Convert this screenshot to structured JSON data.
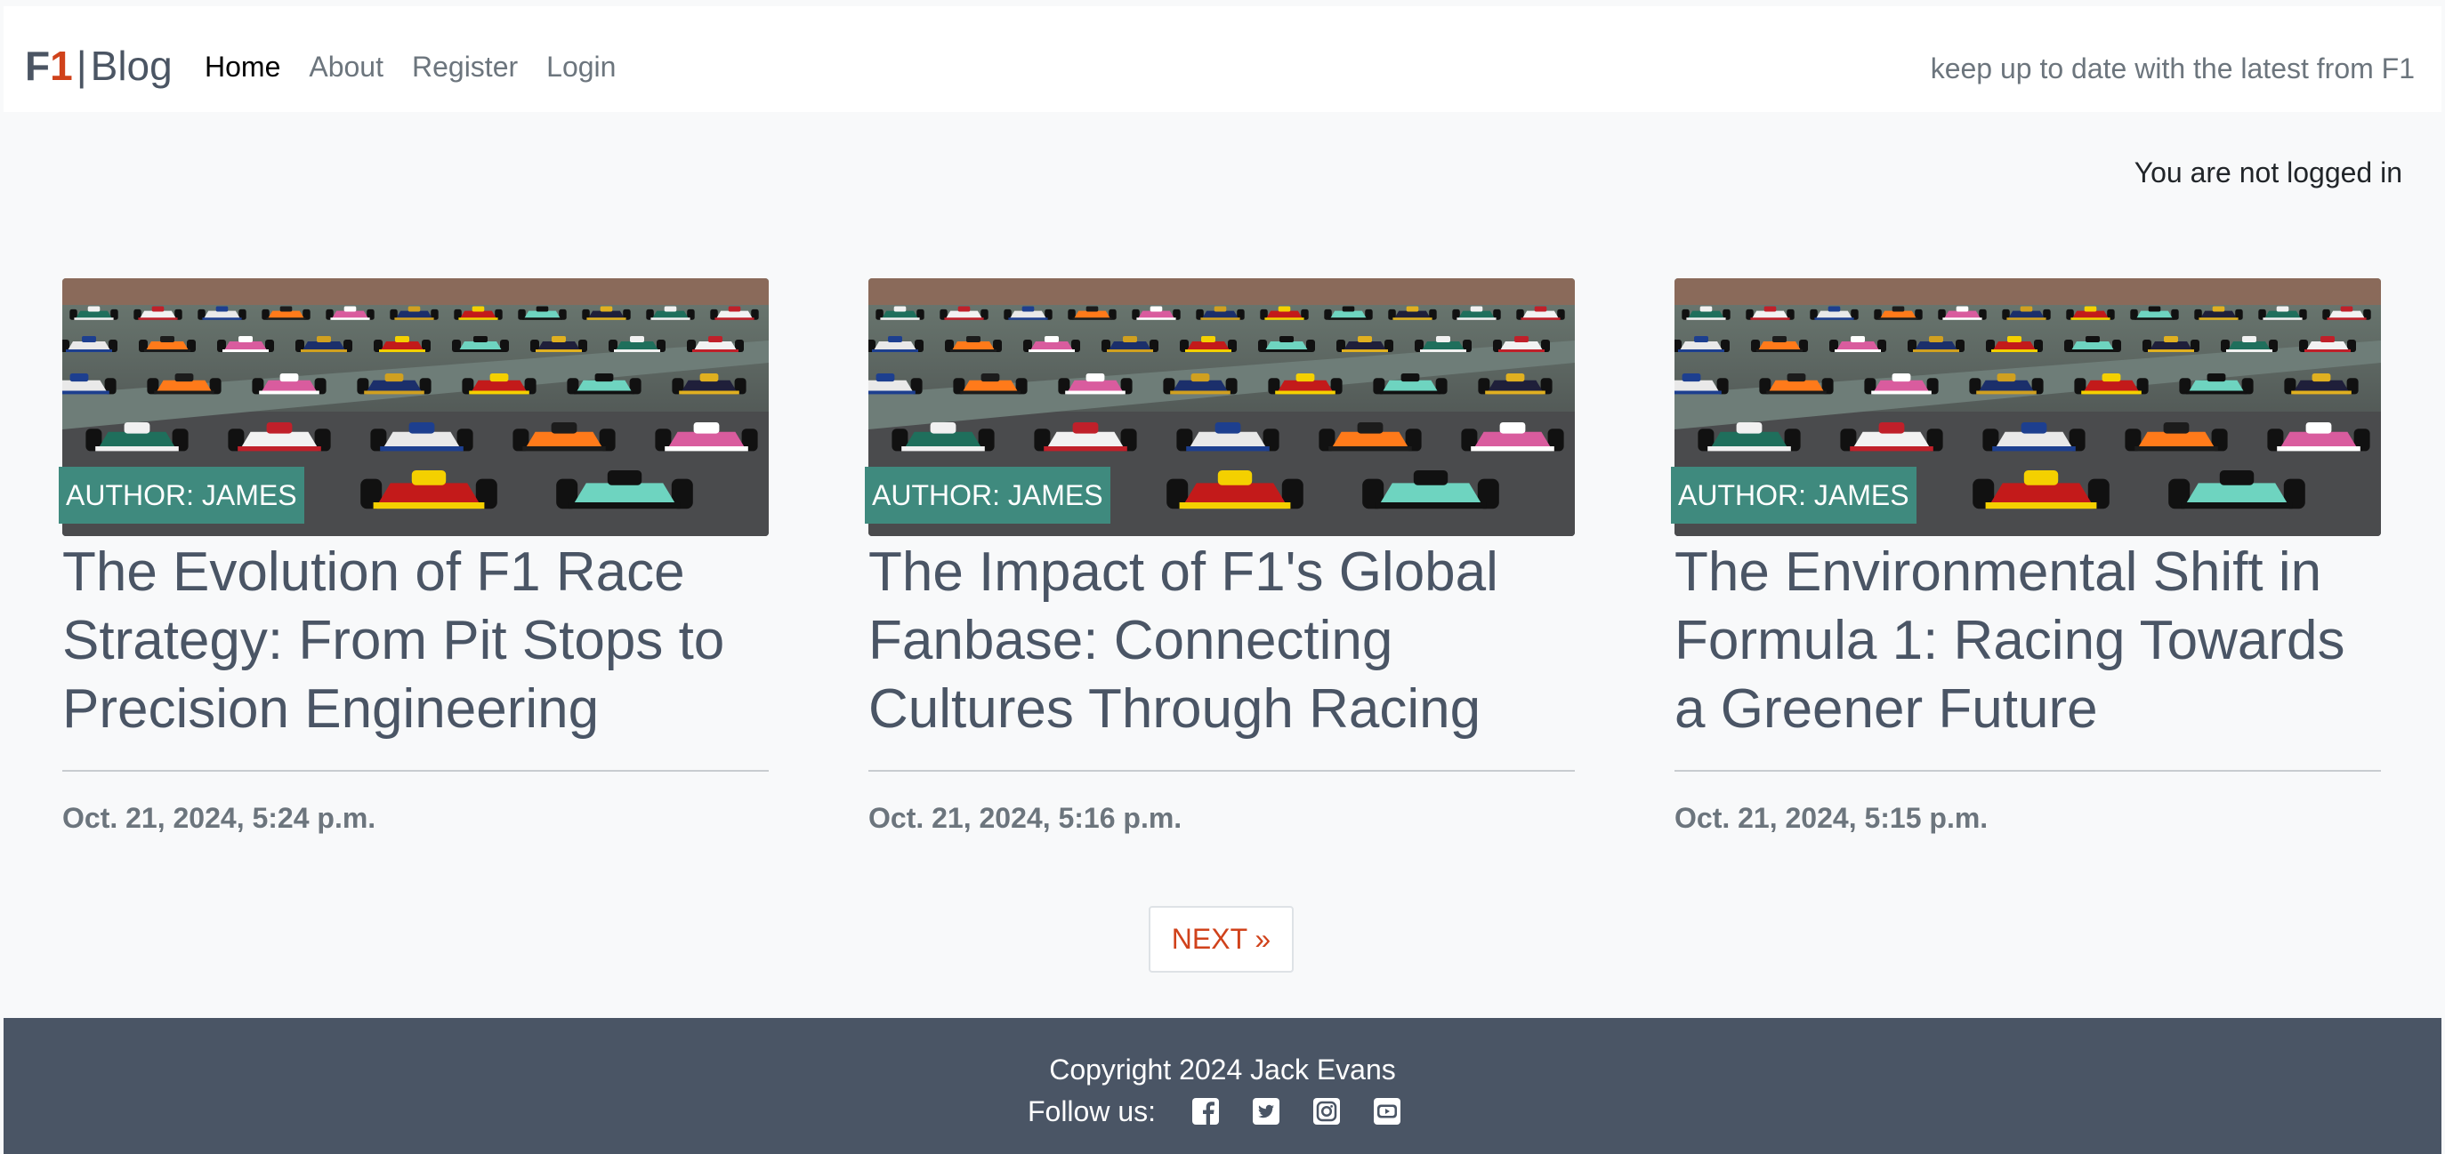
{
  "brand": {
    "f": "F",
    "one": "1",
    "separator": "|",
    "blog": "Blog"
  },
  "nav": {
    "items": [
      {
        "label": "Home"
      },
      {
        "label": "About"
      },
      {
        "label": "Register"
      },
      {
        "label": "Login"
      }
    ],
    "tagline": "keep up to date with the latest from F1"
  },
  "status": {
    "login": "You are not logged in"
  },
  "posts": [
    {
      "author": "AUTHOR: JAMES",
      "title": "The Evolution of F1 Race Strategy: From Pit Stops to Precision Engineering",
      "date": "Oct. 21, 2024, 5:24 p.m."
    },
    {
      "author": "AUTHOR: JAMES",
      "title": "The Impact of F1's Global Fanbase: Connecting Cultures Through Racing",
      "date": "Oct. 21, 2024, 5:16 p.m."
    },
    {
      "author": "AUTHOR: JAMES",
      "title": "The Environmental Shift in Formula 1: Racing Towards a Greener Future",
      "date": "Oct. 21, 2024, 5:15 p.m."
    }
  ],
  "pagination": {
    "next_label": "NEXT »"
  },
  "footer": {
    "copyright": "Copyright 2024 Jack Evans",
    "follow_label": "Follow us:",
    "social_icons": [
      "facebook-icon",
      "twitter-icon",
      "instagram-icon",
      "youtube-icon"
    ]
  },
  "colors": {
    "accent": "#d0421b",
    "badge": "#3f8a7e",
    "footer_bg": "#4a5565",
    "page_bg": "#f8f9fa"
  }
}
